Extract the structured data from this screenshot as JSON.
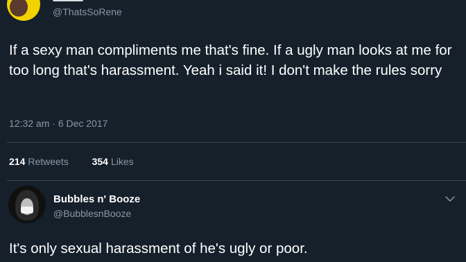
{
  "original_tweet": {
    "handle": "@ThatsSoRene",
    "text": "If a sexy man compliments me that's fine. If a ugly man looks at me for too long that's harassment. Yeah i said it! I don't make the rules sorry",
    "timestamp": "12:32 am · 6 Dec 2017",
    "stats": {
      "retweets_count": "214",
      "retweets_label": "Retweets",
      "likes_count": "354",
      "likes_label": "Likes"
    }
  },
  "reply": {
    "display_name": "Bubbles n' Booze",
    "handle": "@BubblesnBooze",
    "text": "It's only sexual harassment of he's ugly or poor."
  },
  "icons": {
    "more_options": "chevron-down-icon"
  },
  "colors": {
    "background": "#15202b",
    "secondary_text": "#8899a6",
    "divider": "#38444d"
  }
}
